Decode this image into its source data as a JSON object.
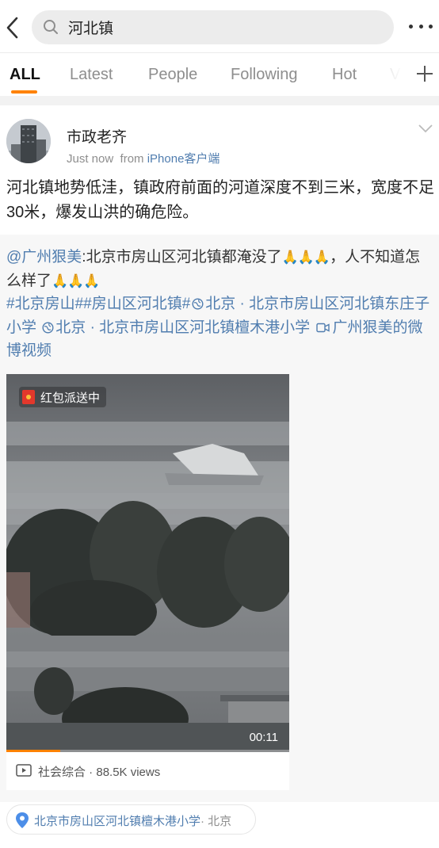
{
  "search": {
    "query": "河北镇"
  },
  "tabs": [
    {
      "label": "ALL"
    },
    {
      "label": "Latest"
    },
    {
      "label": "People"
    },
    {
      "label": "Following"
    },
    {
      "label": "Hot"
    },
    {
      "label": "V"
    }
  ],
  "post": {
    "author": "市政老齐",
    "time": "Just now",
    "from_label": "from",
    "source": "iPhone客户端",
    "text": "河北镇地势低洼，镇政府前面的河道深度不到三米，宽度不足30米，爆发山洪的确危险。"
  },
  "repost": {
    "mention": "@广州狠美",
    "text_a": ":北京市房山区河北镇都淹没了",
    "pray": "🙏🙏🙏",
    "text_b": "，人不知道怎么样了",
    "tag1": "#北京房山#",
    "tag2": "#房山区河北镇#",
    "loc1": "北京 · 北京市房山区河北镇东庄子小学",
    "loc2": "北京 · 北京市房山区河北镇檀木港小学",
    "video_link": "广州狠美的微博视频",
    "video": {
      "badge": "红包派送中",
      "duration": "00:11",
      "progress": 0.19
    },
    "category": "社会综合",
    "views": "88.5K views"
  },
  "location": {
    "name": "北京市房山区河北镇檀木港小学",
    "city": "· 北京"
  },
  "colors": {
    "accent": "#ff8200",
    "link": "#507daf",
    "muted": "#8e8e8e"
  }
}
